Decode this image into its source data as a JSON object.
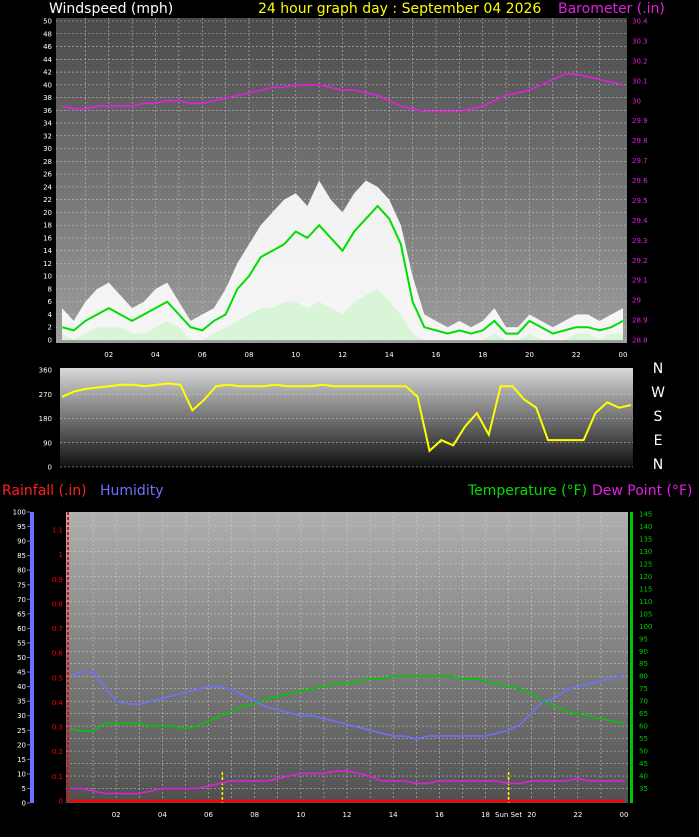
{
  "header": {
    "windspeed_label": "Windspeed (mph)",
    "title": "24 hour graph day : September 04 2026",
    "barometer_label": "Barometer (.in)",
    "rainfall_label": "Rainfall (.in)",
    "humidity_label": "Humidity",
    "temperature_label": "Temperature (°F)",
    "dewpoint_label": "Dew Point (°F)",
    "sunset_label": "Sun Set",
    "compass": [
      "N",
      "W",
      "S",
      "E",
      "N"
    ]
  },
  "colors": {
    "background": "#000000",
    "wind_gust": "#ffffff",
    "wind_average": "#00dd00",
    "wind_min": "#d8f5d8",
    "barometer": "#e020e0",
    "wind_direction": "#ffff00",
    "rain": "#ff0000",
    "humidity": "#7070ff",
    "temperature": "#00c800",
    "dew_point": "#e020e0",
    "sunset_marker": "#ffff00"
  },
  "chart_data": [
    {
      "type": "area",
      "name": "wind",
      "x_hours": [
        0,
        0.5,
        1,
        1.5,
        2,
        2.5,
        3,
        3.5,
        4,
        4.5,
        5,
        5.5,
        6,
        6.5,
        7,
        7.5,
        8,
        8.5,
        9,
        9.5,
        10,
        10.5,
        11,
        11.5,
        12,
        12.5,
        13,
        13.5,
        14,
        14.5,
        15,
        15.5,
        16,
        16.5,
        17,
        17.5,
        18,
        18.5,
        19,
        19.5,
        20,
        20.5,
        21,
        21.5,
        22,
        22.5,
        23,
        23.5,
        24
      ],
      "x_tick_labels": [
        "02",
        "04",
        "06",
        "08",
        "10",
        "12",
        "14",
        "16",
        "18",
        "20",
        "22",
        "00"
      ],
      "x_tick_hours": [
        2,
        4,
        6,
        8,
        10,
        12,
        14,
        16,
        18,
        20,
        22,
        24
      ],
      "series": [
        {
          "key": "gust",
          "values": [
            5,
            3,
            6,
            8,
            9,
            7,
            5,
            6,
            8,
            9,
            6,
            3,
            4,
            5,
            8,
            12,
            15,
            18,
            20,
            22,
            23,
            21,
            25,
            22,
            20,
            23,
            25,
            24,
            22,
            18,
            10,
            4,
            3,
            2,
            3,
            2,
            3,
            5,
            2,
            2,
            4,
            3,
            2,
            3,
            4,
            4,
            3,
            4,
            5
          ]
        },
        {
          "key": "average",
          "values": [
            2,
            1.5,
            3,
            4,
            5,
            4,
            3,
            4,
            5,
            6,
            4,
            2,
            1.5,
            3,
            4,
            8,
            10,
            13,
            14,
            15,
            17,
            16,
            18,
            16,
            14,
            17,
            19,
            21,
            19,
            15,
            6,
            2,
            1.5,
            1,
            1.5,
            1,
            1.5,
            3,
            1,
            1,
            3,
            2,
            1,
            1.5,
            2,
            2,
            1.5,
            2,
            3
          ]
        },
        {
          "key": "min",
          "values": [
            1,
            0,
            1,
            2,
            2,
            2,
            1,
            1,
            2,
            3,
            2,
            0,
            0,
            1,
            2,
            3,
            4,
            5,
            5,
            6,
            6,
            5,
            6,
            5,
            4,
            6,
            7,
            8,
            6,
            4,
            1,
            0,
            0,
            0,
            0,
            0,
            0,
            1,
            0,
            0,
            1,
            0,
            0,
            0,
            1,
            1,
            0,
            1,
            1
          ]
        },
        {
          "key": "barometer",
          "values": [
            30.24,
            30.235,
            30.235,
            30.24,
            30.24,
            30.24,
            30.24,
            30.245,
            30.245,
            30.25,
            30.25,
            30.245,
            30.245,
            30.25,
            30.255,
            30.26,
            30.265,
            30.27,
            30.275,
            30.275,
            30.28,
            30.28,
            30.28,
            30.275,
            30.27,
            30.27,
            30.265,
            30.26,
            30.25,
            30.24,
            30.235,
            30.23,
            30.23,
            30.23,
            30.23,
            30.235,
            30.24,
            30.25,
            30.26,
            30.265,
            30.27,
            30.28,
            30.29,
            30.3,
            30.3,
            30.295,
            30.29,
            30.285,
            30.28
          ]
        }
      ],
      "y_left_range": [
        0,
        50
      ],
      "y_left_ticks": [
        0,
        2,
        4,
        6,
        8,
        10,
        12,
        14,
        16,
        18,
        20,
        22,
        24,
        26,
        28,
        30,
        32,
        34,
        36,
        38,
        40,
        42,
        44,
        46,
        48,
        50
      ],
      "y_right_range": [
        29.8,
        30.4
      ],
      "y_right_ticks": [
        "29.8",
        "29.9",
        "29.9",
        "29.9",
        "29.9",
        "29.9",
        "29.9",
        "29.9",
        "29.9",
        "29.9",
        "29.9",
        "30",
        "30",
        "30",
        "30",
        "30",
        "30",
        "30",
        "30",
        "30",
        "30",
        "30.1",
        "30.1",
        "30.1",
        "30.1",
        "30.2",
        "30.2",
        "30.3",
        "30.3",
        "30.4",
        "30.4",
        "30.4",
        "30.4"
      ],
      "y_right_tick_labels": [
        "28.8",
        "28.9",
        "29",
        "29.1",
        "29.2",
        "29.3",
        "29.4",
        "29.5",
        "29.6",
        "29.7",
        "29.8",
        "29.9",
        "30",
        "30.1",
        "30.2",
        "30.3",
        "30.4"
      ],
      "grid": true
    },
    {
      "type": "line",
      "name": "wind_direction",
      "x_hours": [
        0,
        0.5,
        1,
        1.5,
        2,
        2.5,
        3,
        3.5,
        4,
        4.5,
        5,
        5.5,
        6,
        6.5,
        7,
        7.5,
        8,
        8.5,
        9,
        9.5,
        10,
        10.5,
        11,
        11.5,
        12,
        12.5,
        13,
        13.5,
        14,
        14.5,
        15,
        15.5,
        16,
        16.5,
        17,
        17.5,
        18,
        18.5,
        19,
        19.5,
        20,
        20.5,
        21,
        21.5,
        22,
        22.5,
        23,
        23.5,
        24
      ],
      "values": [
        260,
        280,
        290,
        295,
        300,
        305,
        305,
        300,
        305,
        310,
        305,
        210,
        250,
        300,
        305,
        300,
        300,
        300,
        305,
        300,
        300,
        300,
        305,
        300,
        300,
        300,
        300,
        300,
        300,
        300,
        260,
        60,
        100,
        80,
        150,
        200,
        120,
        300,
        300,
        250,
        220,
        100,
        100,
        100,
        100,
        200,
        240,
        220,
        230
      ],
      "y_range": [
        0,
        360
      ],
      "y_ticks": [
        0,
        90,
        180,
        270,
        360
      ],
      "grid": true
    },
    {
      "type": "line",
      "name": "rain_humidity_temperature",
      "x_hours": [
        0,
        0.5,
        1,
        1.5,
        2,
        2.5,
        3,
        3.5,
        4,
        4.5,
        5,
        5.5,
        6,
        6.5,
        7,
        7.5,
        8,
        8.5,
        9,
        9.5,
        10,
        10.5,
        11,
        11.5,
        12,
        12.5,
        13,
        13.5,
        14,
        14.5,
        15,
        15.5,
        16,
        16.5,
        17,
        17.5,
        18,
        18.5,
        19,
        19.5,
        20,
        20.5,
        21,
        21.5,
        22,
        22.5,
        23,
        23.5,
        24
      ],
      "x_tick_labels": [
        "02",
        "04",
        "06",
        "08",
        "10",
        "12",
        "14",
        "16",
        "18",
        "20",
        "22",
        "00"
      ],
      "x_tick_hours": [
        2,
        4,
        6,
        8,
        10,
        12,
        14,
        16,
        18,
        20,
        22,
        24
      ],
      "sunset_hour": 19.0,
      "sunrise_hour": 6.6,
      "series": [
        {
          "key": "humidity",
          "values": [
            44,
            45,
            45,
            40,
            35,
            34,
            34,
            35,
            36,
            37,
            38,
            39,
            40,
            40,
            39,
            37,
            35,
            33,
            32,
            31,
            30,
            30,
            29,
            28,
            27,
            26,
            25,
            24,
            23,
            23,
            22,
            23,
            23,
            23,
            23,
            23,
            23,
            24,
            25,
            27,
            31,
            35,
            36,
            39,
            40,
            41,
            42,
            43,
            44
          ]
        },
        {
          "key": "rainfall",
          "values": [
            0,
            0,
            0,
            0,
            0,
            0,
            0,
            0,
            0,
            0,
            0,
            0,
            0,
            0,
            0,
            0,
            0,
            0,
            0,
            0,
            0,
            0,
            0,
            0,
            0,
            0,
            0,
            0,
            0,
            0,
            0,
            0,
            0,
            0,
            0,
            0,
            0,
            0,
            0,
            0,
            0,
            0,
            0,
            0,
            0,
            0,
            0,
            0,
            0
          ]
        },
        {
          "key": "temperature",
          "values": [
            59,
            58,
            58,
            61,
            61,
            61,
            61,
            60,
            60,
            60,
            59,
            60,
            62,
            64,
            66,
            68,
            69,
            71,
            72,
            73,
            74,
            75,
            76,
            77,
            77,
            78,
            79,
            79,
            80,
            80,
            80,
            80,
            80,
            80,
            79,
            79,
            78,
            77,
            76,
            75,
            73,
            70,
            68,
            66,
            65,
            64,
            63,
            62,
            61
          ]
        },
        {
          "key": "dew_point",
          "values": [
            35,
            35,
            34,
            33,
            33,
            33,
            33,
            34,
            35,
            35,
            35,
            35,
            36,
            37,
            38,
            38,
            38,
            38,
            39,
            40,
            41,
            41,
            41,
            42,
            42,
            41,
            40,
            38,
            38,
            38,
            37,
            37,
            38,
            38,
            38,
            38,
            38,
            38,
            37,
            37,
            38,
            38,
            38,
            38,
            39,
            38,
            38,
            38,
            38
          ]
        }
      ],
      "y_humidity_range": [
        0,
        100
      ],
      "y_humidity_ticks": [
        0,
        5,
        10,
        15,
        20,
        25,
        30,
        35,
        40,
        45,
        50,
        55,
        60,
        65,
        70,
        75,
        80,
        85,
        90,
        95,
        100
      ],
      "y_rain_range": [
        0,
        1.1
      ],
      "y_rain_ticks": [
        "0",
        "0.1",
        "0.2",
        "0.3",
        "0.4",
        "0.5",
        "0.6",
        "0.7",
        "0.8",
        "0.9",
        "1",
        "1.1"
      ],
      "y_temp_range": [
        30,
        145
      ],
      "y_temp_ticks": [
        35,
        40,
        45,
        50,
        55,
        60,
        65,
        70,
        75,
        80,
        85,
        90,
        95,
        100,
        105,
        110,
        115,
        120,
        125,
        130,
        135,
        140,
        145
      ],
      "grid": true
    }
  ]
}
